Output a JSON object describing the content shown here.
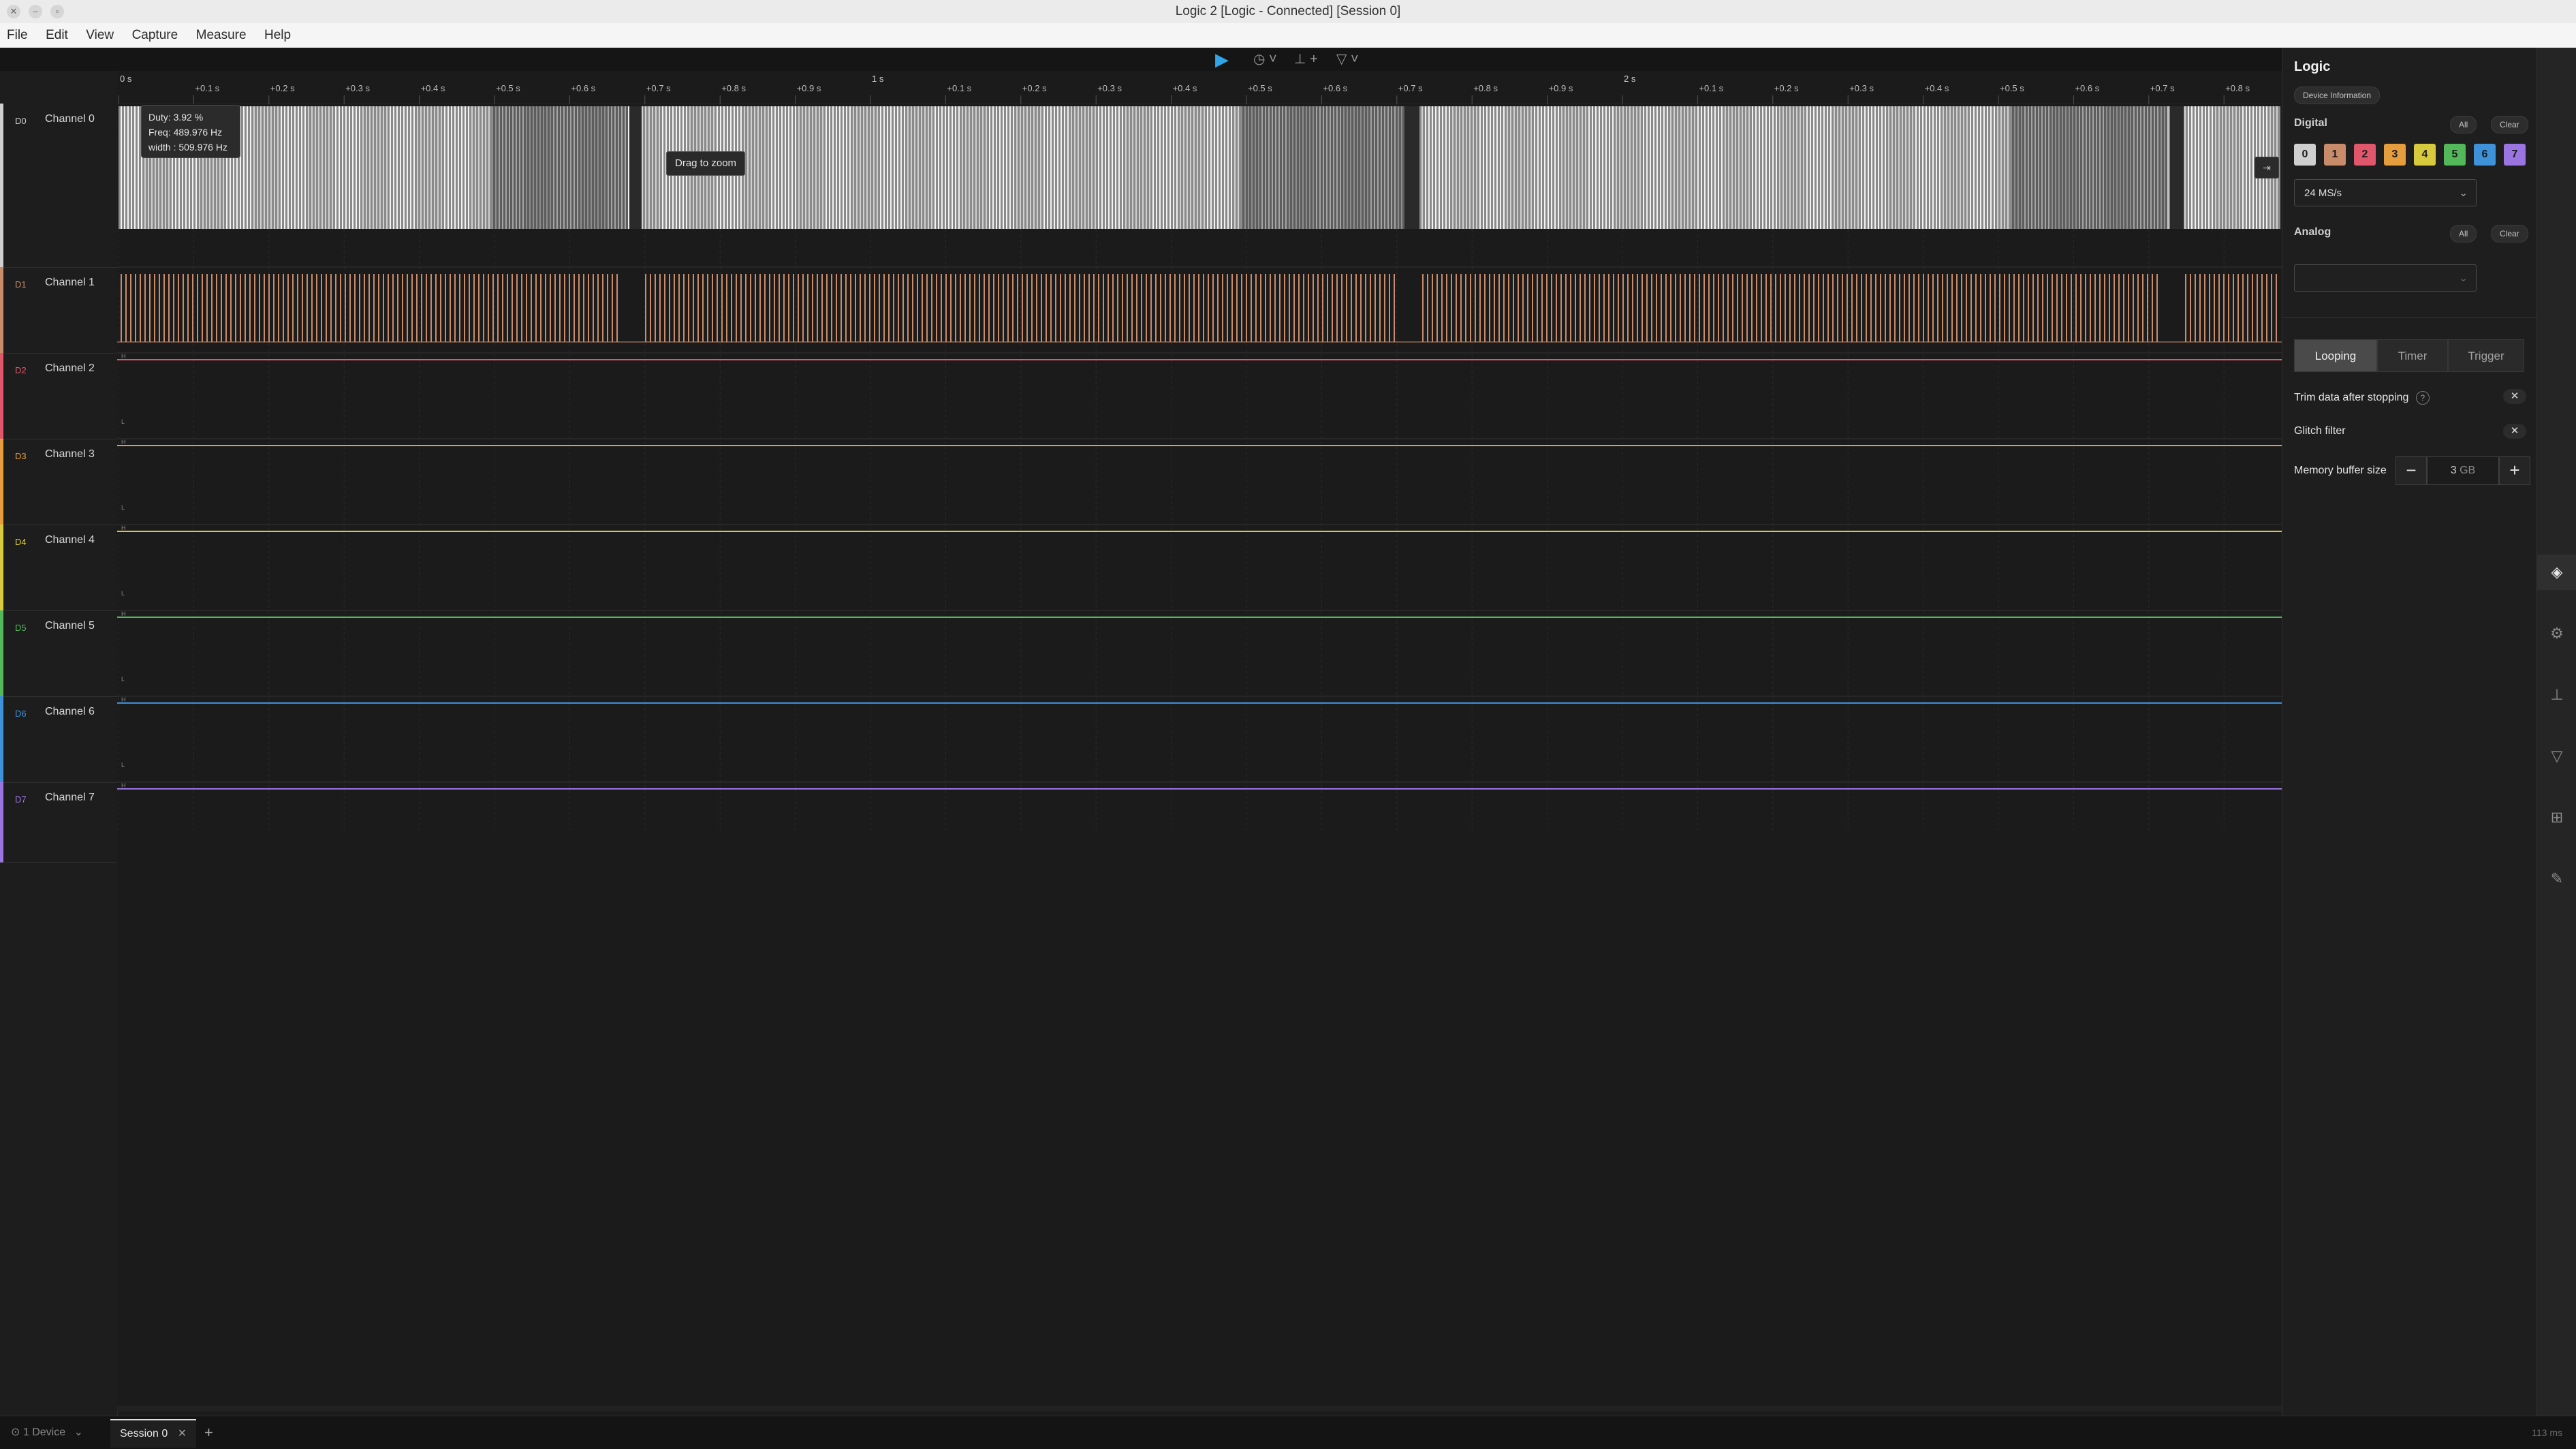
{
  "window": {
    "title": "Logic 2 [Logic - Connected] [Session 0]"
  },
  "menu": [
    "File",
    "Edit",
    "View",
    "Capture",
    "Measure",
    "Help"
  ],
  "timeline": {
    "ticks": [
      "0 s",
      "+0.1 s",
      "+0.2 s",
      "+0.3 s",
      "+0.4 s",
      "+0.5 s",
      "+0.6 s",
      "+0.7 s",
      "+0.8 s",
      "+0.9 s",
      "1 s",
      "+0.1 s",
      "+0.2 s",
      "+0.3 s",
      "+0.4 s",
      "+0.5 s",
      "+0.6 s",
      "+0.7 s",
      "+0.8 s",
      "+0.9 s",
      "2 s",
      "+0.1 s",
      "+0.2 s",
      "+0.3 s",
      "+0.4 s",
      "+0.5 s",
      "+0.6 s",
      "+0.7 s",
      "+0.8 s"
    ]
  },
  "channels": [
    {
      "id": "D0",
      "name": "Channel 0",
      "color": "#cfcfcf"
    },
    {
      "id": "D1",
      "name": "Channel 1",
      "color": "#c98c6a"
    },
    {
      "id": "D2",
      "name": "Channel 2",
      "color": "#e0566a"
    },
    {
      "id": "D3",
      "name": "Channel 3",
      "color": "#e69d3e"
    },
    {
      "id": "D4",
      "name": "Channel 4",
      "color": "#d8ca3d"
    },
    {
      "id": "D5",
      "name": "Channel 5",
      "color": "#52b85a"
    },
    {
      "id": "D6",
      "name": "Channel 6",
      "color": "#3d92d9"
    },
    {
      "id": "D7",
      "name": "Channel 7",
      "color": "#9a74e0"
    }
  ],
  "tooltip": {
    "duty": "Duty: 3.92 %",
    "freq": "Freq: 489.976 Hz",
    "width": "width : 509.976 Hz",
    "zoom": "Drag to zoom"
  },
  "panel": {
    "title": "Logic",
    "device_info": "Device Information",
    "digital": "Digital",
    "all": "All",
    "clear": "Clear",
    "digital_channels": [
      "0",
      "1",
      "2",
      "3",
      "4",
      "5",
      "6",
      "7"
    ],
    "sample_rate": "24 MS/s",
    "analog": "Analog",
    "analog_all": "All",
    "analog_clear": "Clear",
    "mode_tabs": [
      "Looping",
      "Timer",
      "Trigger"
    ],
    "trim_label": "Trim data after stopping",
    "glitch_label": "Glitch filter",
    "memory_label": "Memory buffer size",
    "memory_value": "3",
    "memory_unit": "GB"
  },
  "status": {
    "device": "1 Device",
    "session_tab": "Session 0",
    "timing": "113 ms"
  },
  "icons": {
    "play": "play-icon",
    "timer": "timer-icon",
    "cursor": "cursor-icon",
    "trigger": "trigger-icon"
  }
}
